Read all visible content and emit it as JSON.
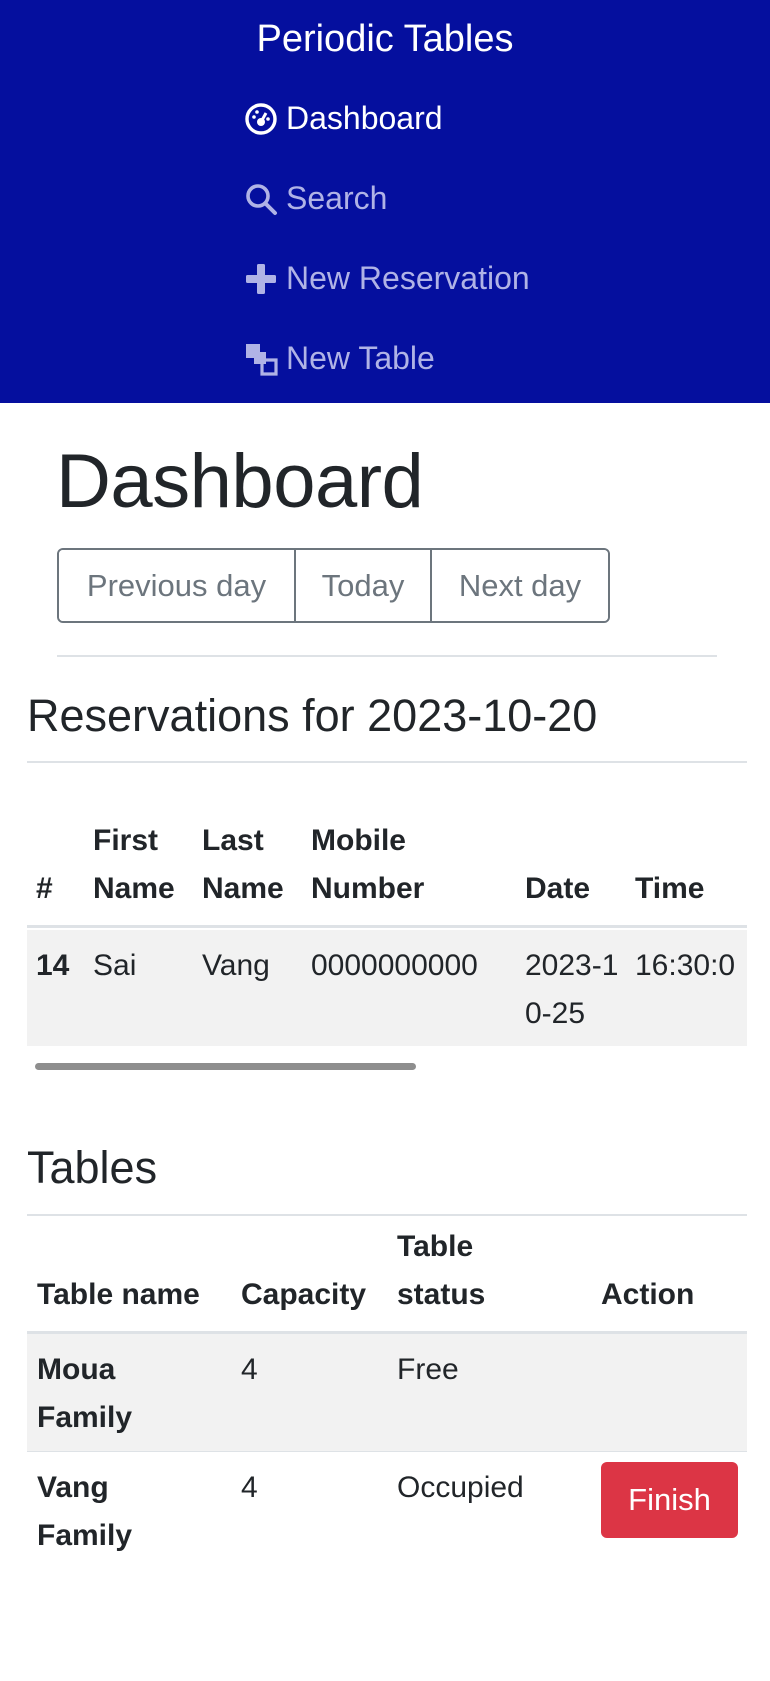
{
  "nav": {
    "title": "Periodic Tables",
    "items": [
      {
        "label": "Dashboard",
        "icon": "dashboard-icon"
      },
      {
        "label": "Search",
        "icon": "search-icon"
      },
      {
        "label": "New Reservation",
        "icon": "plus-icon"
      },
      {
        "label": "New Table",
        "icon": "layers-icon"
      }
    ]
  },
  "page": {
    "title": "Dashboard",
    "day_nav": {
      "previous": "Previous day",
      "today": "Today",
      "next": "Next day"
    }
  },
  "reservations": {
    "heading": "Reservations for 2023-10-20",
    "columns": [
      "#",
      "First Name",
      "Last Name",
      "Mobile Number",
      "Date",
      "Time"
    ],
    "rows": [
      {
        "id": "14",
        "first_name": "Sai",
        "last_name": "Vang",
        "mobile": "0000000000",
        "date": "2023-10-25",
        "time": "16:30:0"
      }
    ]
  },
  "tables": {
    "heading": "Tables",
    "columns": [
      "Table name",
      "Capacity",
      "Table status",
      "Action"
    ],
    "rows": [
      {
        "name": "Moua Family",
        "capacity": "4",
        "status": "Free",
        "action": ""
      },
      {
        "name": "Vang Family",
        "capacity": "4",
        "status": "Occupied",
        "action": "Finish"
      }
    ]
  },
  "colors": {
    "nav_background": "#050f9e",
    "finish_button": "#dc3545",
    "outline_button": "#6c757d"
  }
}
